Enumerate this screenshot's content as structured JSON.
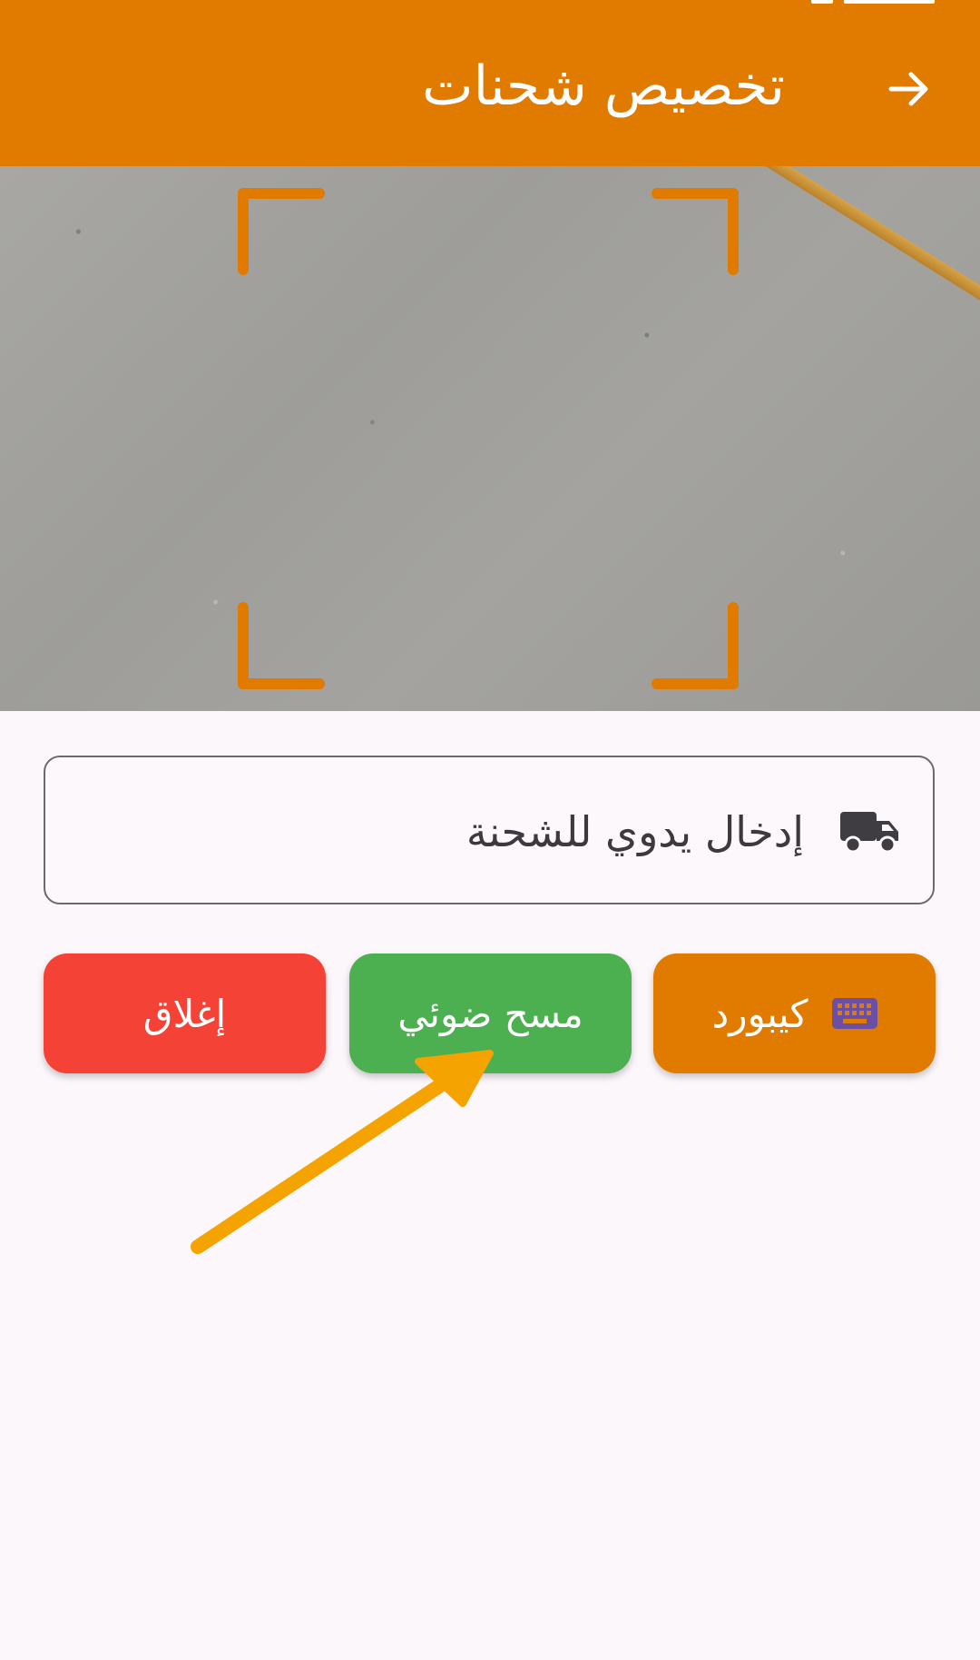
{
  "appbar": {
    "title": "تخصيص شحنات",
    "background": "#e07b00"
  },
  "camera": {
    "frame_color": "#e07b00"
  },
  "manual_entry": {
    "label": "إدخال يدوي للشحنة",
    "icon": "truck-icon"
  },
  "buttons": {
    "keyboard": {
      "label": "كيبورد",
      "icon": "keyboard-icon",
      "color": "#e07b00"
    },
    "scan": {
      "label": "مسح ضوئي",
      "color": "#4caf50"
    },
    "close": {
      "label": "إغلاق",
      "color": "#f44336"
    }
  },
  "annotation": {
    "arrow_color": "#f5a300"
  }
}
